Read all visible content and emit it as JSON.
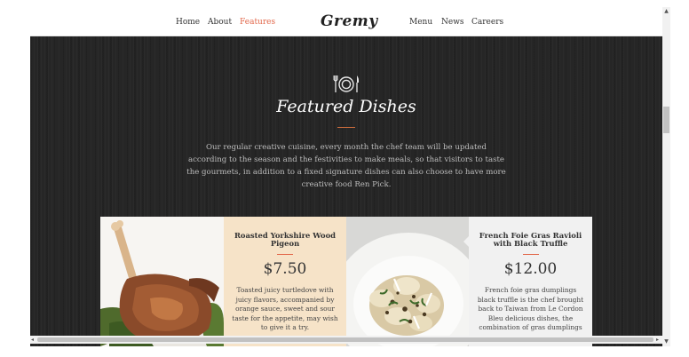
{
  "nav": {
    "left_links": [
      "Home",
      "About",
      "Features"
    ],
    "logo": "Gremy",
    "right_links": [
      "Menu",
      "News",
      "Careers"
    ],
    "active": "Features",
    "active_color": "#e2674a"
  },
  "hero": {
    "icon": "plate-fork-knife-icon",
    "title": "Featured Dishes",
    "description": "Our regular creative cuisine, every month the chef team will be updated according to the season and the festivities to make meals, so that visitors to taste the gourmets, in addition to a fixed signature dishes can also choose to have more creative food Ren Pick."
  },
  "dishes": [
    {
      "title": "Roasted Yorkshire Wood Pigeon",
      "price": "$7.50",
      "description": "Toasted juicy turtledove with juicy flavors, accompanied by orange sauce, sweet and sour taste for the appetite, may wish to give it a try.",
      "image": "roasted-pigeon-image",
      "bg_color": "#f6e3c8"
    },
    {
      "title": "French Foie Gras Ravioli with Black Truffle",
      "price": "$12.00",
      "description": "French foie gras dumplings black truffle is the chef brought back to Taiwan from Le Cordon Bleu delicious dishes, the combination of gras dumplings",
      "image": "foie-gras-ravioli-image",
      "bg_color": "#f1f1f1"
    }
  ]
}
